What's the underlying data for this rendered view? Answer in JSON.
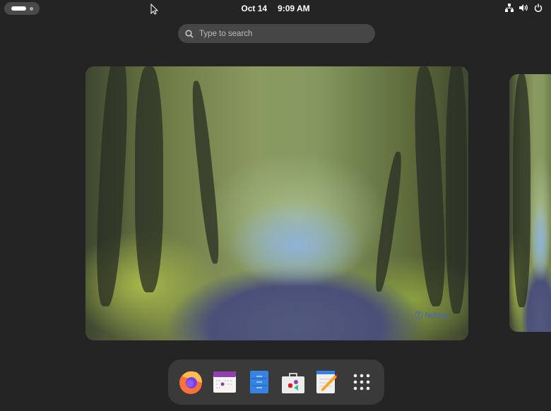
{
  "topbar": {
    "date": "Oct 14",
    "time": "9:09 AM",
    "tray_icons": [
      "network-icon",
      "volume-icon",
      "power-icon"
    ]
  },
  "search": {
    "placeholder": "Type to search"
  },
  "wallpaper": {
    "logo_text": "fedora"
  },
  "dock": {
    "apps": [
      {
        "name": "Firefox",
        "icon": "firefox-icon"
      },
      {
        "name": "Calendar",
        "icon": "calendar-icon"
      },
      {
        "name": "Files",
        "icon": "files-icon"
      },
      {
        "name": "Software",
        "icon": "software-icon"
      },
      {
        "name": "Text Editor",
        "icon": "text-editor-icon"
      },
      {
        "name": "Show Apps",
        "icon": "app-grid-icon"
      }
    ]
  },
  "colors": {
    "background": "#242424",
    "dock": "#3a3a3a",
    "search": "#464646"
  }
}
